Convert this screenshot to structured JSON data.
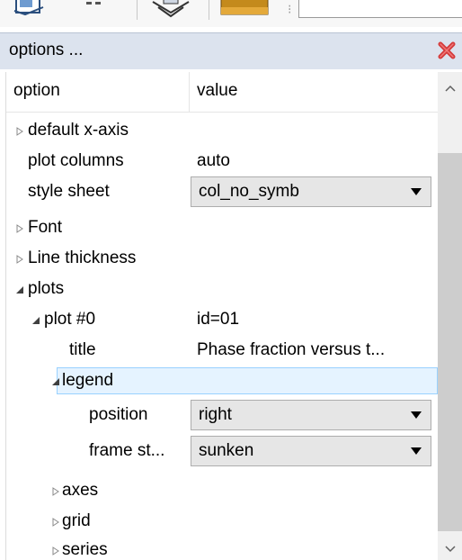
{
  "panel": {
    "title": "options ..."
  },
  "tree": {
    "header": {
      "option": "option",
      "value": "value"
    },
    "rows": {
      "default_x_axis": {
        "label": "default x-axis"
      },
      "plot_columns": {
        "label": "plot columns",
        "value": "auto"
      },
      "style_sheet": {
        "label": "style sheet",
        "value": "col_no_symb"
      },
      "font": {
        "label": "Font"
      },
      "line_thickness": {
        "label": "Line thickness"
      },
      "plots": {
        "label": "plots"
      },
      "plot0": {
        "label": "plot #0",
        "value": "id=01"
      },
      "title": {
        "label": "title",
        "value": "Phase fraction versus t..."
      },
      "legend": {
        "label": "legend"
      },
      "position": {
        "label": "position",
        "value": "right"
      },
      "frame_style": {
        "label": "frame st...",
        "value": "sunken"
      },
      "axes": {
        "label": "axes"
      },
      "grid": {
        "label": "grid"
      },
      "series": {
        "label": "series"
      }
    }
  },
  "colors": {
    "title_bar": "#dce3ee",
    "selection_bg": "#e5f3ff",
    "selection_border": "#99d1ff",
    "close_red": "#d43a3a"
  },
  "icons": {
    "close": "close-x-icon",
    "collapsed": "triangle-collapsed-icon",
    "expanded": "triangle-expanded-icon",
    "dropdown": "dropdown-arrow-icon",
    "scroll_up": "chevron-up-icon",
    "scroll_down": "chevron-down-icon"
  }
}
